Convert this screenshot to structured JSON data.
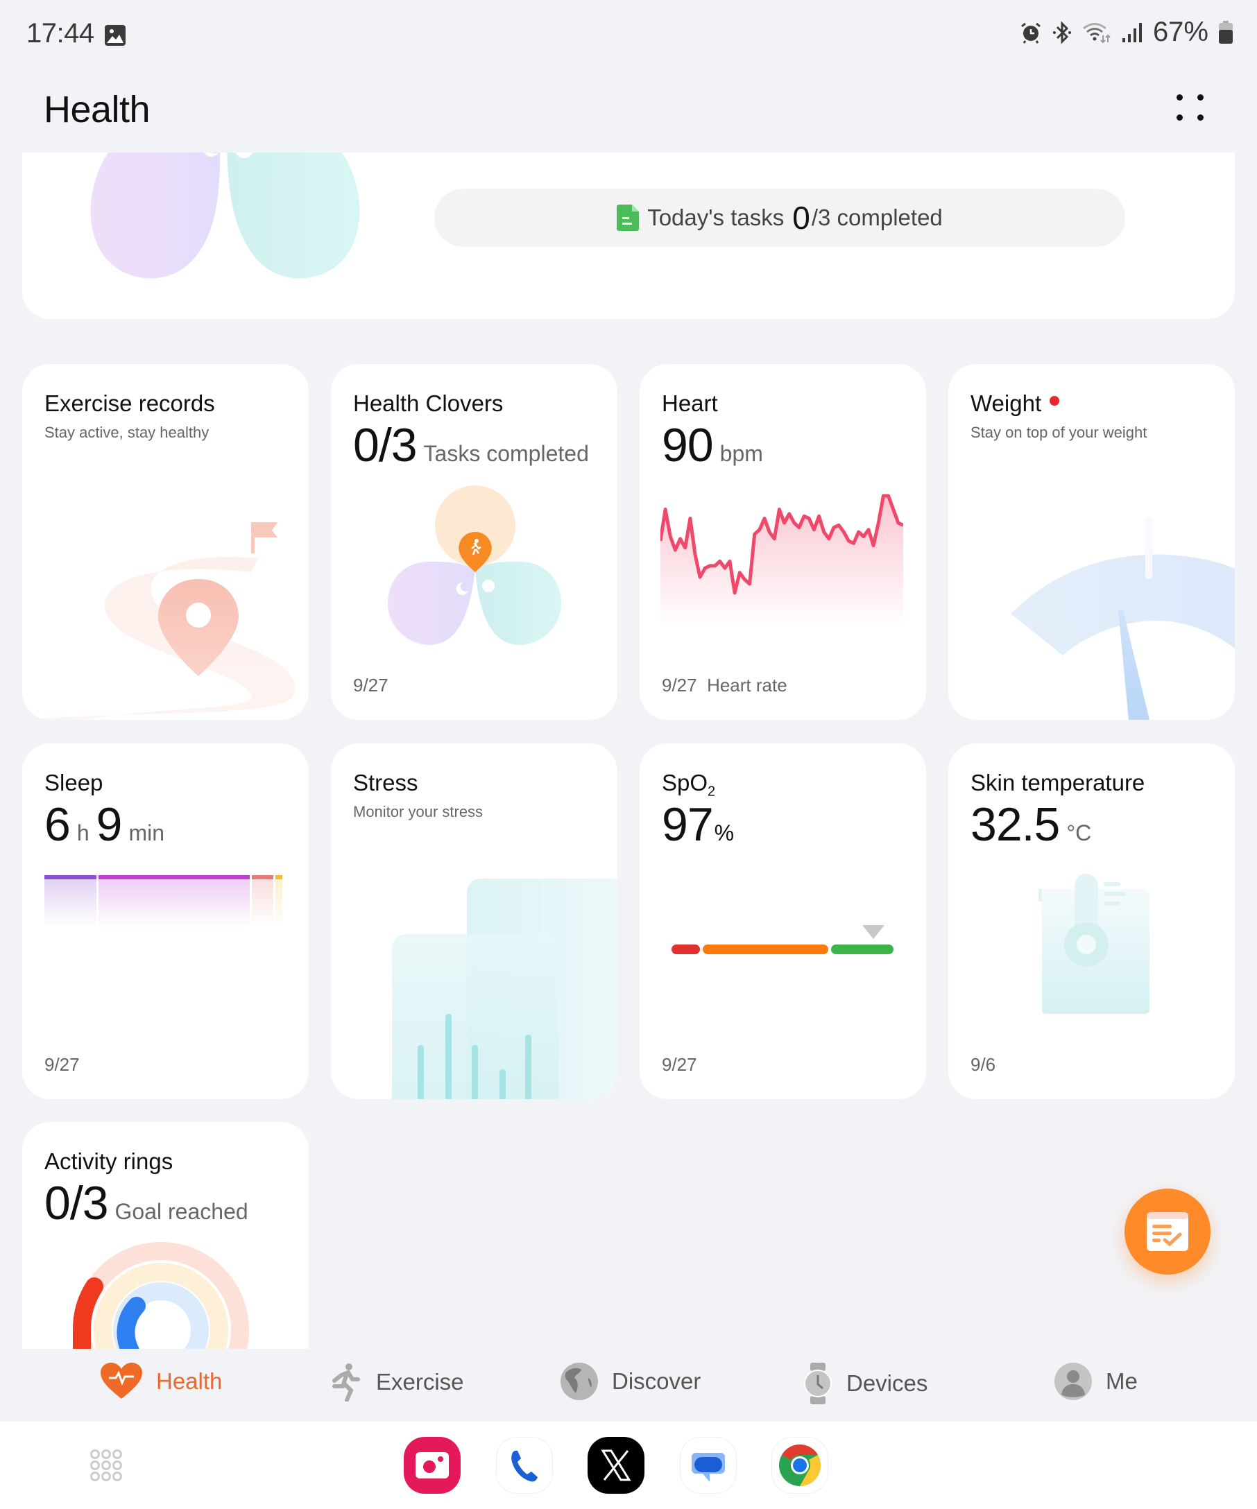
{
  "status_bar": {
    "time": "17:44",
    "notification_icons": [
      "gallery-icon"
    ],
    "system_icons": [
      "alarm-icon",
      "bluetooth-icon",
      "wifi-icon",
      "signal-icon"
    ],
    "battery_percent": "67%"
  },
  "header": {
    "title": "Health",
    "menu_icon": "more-grid-icon"
  },
  "top_card": {
    "tasks_label": "Today's tasks",
    "tasks_done": "0",
    "tasks_rest": "/3 completed",
    "icon": "task-document-icon"
  },
  "cards": {
    "exercise": {
      "title": "Exercise records",
      "subtitle": "Stay active, stay healthy"
    },
    "clovers": {
      "title": "Health Clovers",
      "value": "0/3",
      "unit": "Tasks completed",
      "date": "9/27"
    },
    "heart": {
      "title": "Heart",
      "value": "90",
      "unit": "bpm",
      "date": "9/27",
      "date_label": "Heart rate",
      "line_color": "#f0486a",
      "series": [
        78,
        92,
        80,
        74,
        79,
        75,
        88,
        72,
        62,
        66,
        67,
        67,
        69,
        66,
        69,
        55,
        64,
        61,
        59,
        81,
        83,
        88,
        82,
        79,
        92,
        86,
        90,
        86,
        84,
        89,
        88,
        83,
        89,
        82,
        79,
        84,
        85,
        82,
        78,
        77,
        82,
        80,
        83,
        76,
        86,
        98,
        98,
        92,
        86,
        85
      ]
    },
    "weight": {
      "title": "Weight",
      "subtitle": "Stay on top of your weight",
      "has_alert": true
    },
    "sleep": {
      "title": "Sleep",
      "hours": "6",
      "hours_unit": "h",
      "minutes": "9",
      "minutes_unit": "min",
      "date": "9/27",
      "stages": [
        {
          "name": "deep",
          "fraction": 0.22,
          "color": "#8a4fd3"
        },
        {
          "name": "light",
          "fraction": 0.64,
          "color": "#c03ed0"
        },
        {
          "name": "rem",
          "fraction": 0.09,
          "color": "#e87a7a"
        },
        {
          "name": "awake",
          "fraction": 0.03,
          "color": "#f2bd2f"
        }
      ]
    },
    "stress": {
      "title": "Stress",
      "subtitle": "Monitor your stress"
    },
    "spo2": {
      "title_main": "SpO",
      "title_sub": "2",
      "value": "97",
      "unit": "%",
      "date": "9/27",
      "segments": [
        {
          "name": "low",
          "color": "#e03131"
        },
        {
          "name": "medium",
          "color": "#fd7a0f"
        },
        {
          "name": "normal",
          "color": "#3cb44a"
        }
      ],
      "marker_fraction": 0.91
    },
    "skin_temp": {
      "title": "Skin temperature",
      "value": "32.5",
      "unit": "°C",
      "date": "9/6"
    },
    "activity": {
      "title": "Activity rings",
      "value": "0/3",
      "unit": "Goal reached"
    }
  },
  "fab": {
    "icon": "task-checklist-icon"
  },
  "bottom_nav": {
    "items": [
      {
        "label": "Health",
        "icon": "heart-pulse-icon",
        "active": true
      },
      {
        "label": "Exercise",
        "icon": "running-icon",
        "active": false
      },
      {
        "label": "Discover",
        "icon": "globe-icon",
        "active": false
      },
      {
        "label": "Devices",
        "icon": "watch-icon",
        "active": false
      },
      {
        "label": "Me",
        "icon": "person-icon",
        "active": false
      }
    ]
  },
  "dock": {
    "apps": [
      {
        "name": "App drawer",
        "icon": "app-drawer-icon"
      },
      {
        "name": "Camera",
        "icon": "camera-icon"
      },
      {
        "name": "Phone",
        "icon": "phone-icon"
      },
      {
        "name": "X",
        "icon": "x-icon"
      },
      {
        "name": "Messages",
        "icon": "messages-icon"
      },
      {
        "name": "Chrome",
        "icon": "chrome-icon"
      }
    ]
  }
}
